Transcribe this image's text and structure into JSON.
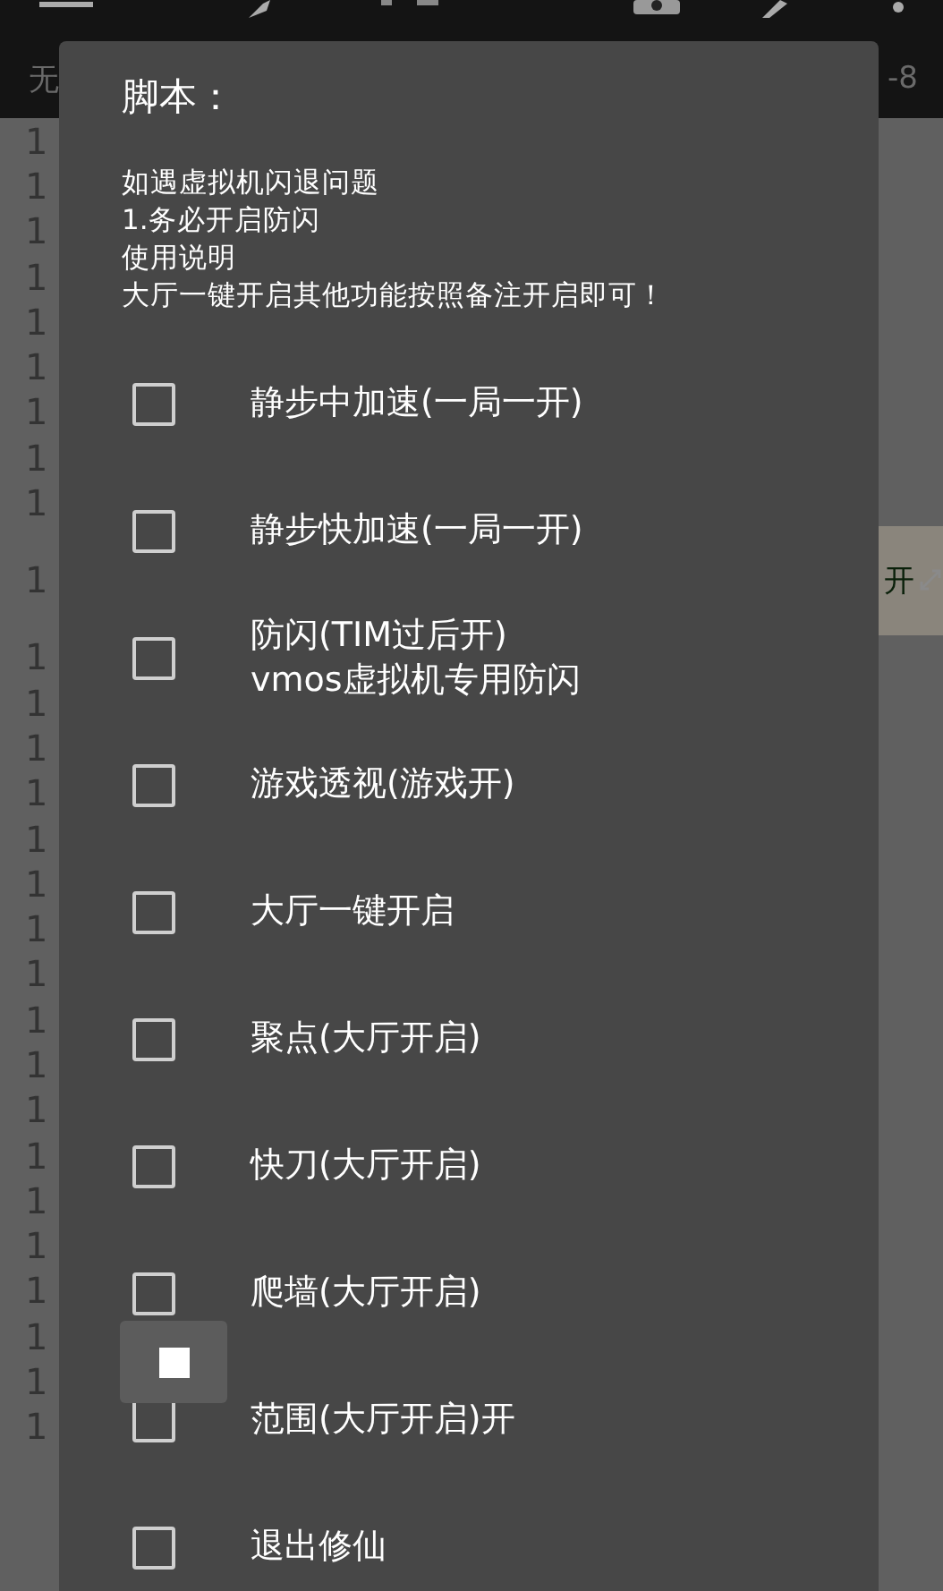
{
  "tab_bar": {
    "left_text": "无",
    "right_text": "-8"
  },
  "editor_rows": [
    {
      "kind": "line",
      "number": "1"
    },
    {
      "kind": "line",
      "number": "1"
    },
    {
      "kind": "line",
      "number": "1"
    },
    {
      "kind": "line",
      "number": "1"
    },
    {
      "kind": "line",
      "number": "1"
    },
    {
      "kind": "line",
      "number": "1"
    },
    {
      "kind": "line",
      "number": "1"
    },
    {
      "kind": "line",
      "number": "1"
    },
    {
      "kind": "line",
      "number": "1"
    },
    {
      "kind": "tall",
      "number": "1",
      "tail": "开"
    },
    {
      "kind": "line",
      "number": "1"
    },
    {
      "kind": "line",
      "number": "1"
    },
    {
      "kind": "line",
      "number": "1"
    },
    {
      "kind": "line",
      "number": "1"
    },
    {
      "kind": "line",
      "number": "1"
    },
    {
      "kind": "line",
      "number": "1"
    },
    {
      "kind": "line",
      "number": "1"
    },
    {
      "kind": "line",
      "number": "1"
    },
    {
      "kind": "line",
      "number": "1"
    },
    {
      "kind": "line",
      "number": "1"
    },
    {
      "kind": "line",
      "number": "1"
    },
    {
      "kind": "line",
      "number": "1"
    },
    {
      "kind": "line",
      "number": "1"
    },
    {
      "kind": "line",
      "number": "1"
    },
    {
      "kind": "line",
      "number": "1"
    },
    {
      "kind": "line",
      "number": "1"
    },
    {
      "kind": "line",
      "number": "1"
    },
    {
      "kind": "line",
      "number": "1"
    }
  ],
  "dialog": {
    "title": "脚本：",
    "message": [
      "如遇虚拟机闪退问题",
      "1.务必开启防闪",
      "使用说明",
      "大厅一键开启其他功能按照备注开启即可！"
    ],
    "options": [
      {
        "label": [
          "静步中加速(一局一开)"
        ],
        "checked": false
      },
      {
        "label": [
          "静步快加速(一局一开)"
        ],
        "checked": false
      },
      {
        "label": [
          "防闪(TIM过后开)",
          "vmos虚拟机专用防闪"
        ],
        "checked": false
      },
      {
        "label": [
          "游戏透视(游戏开)"
        ],
        "checked": false
      },
      {
        "label": [
          "大厅一键开启"
        ],
        "checked": false
      },
      {
        "label": [
          "聚点(大厅开启)"
        ],
        "checked": false
      },
      {
        "label": [
          "快刀(大厅开启)"
        ],
        "checked": false
      },
      {
        "label": [
          "爬墙(大厅开启)"
        ],
        "checked": false
      },
      {
        "label": [
          "范围(大厅开启)开"
        ],
        "checked": false
      },
      {
        "label": [
          "退出修仙"
        ],
        "checked": false
      }
    ]
  }
}
